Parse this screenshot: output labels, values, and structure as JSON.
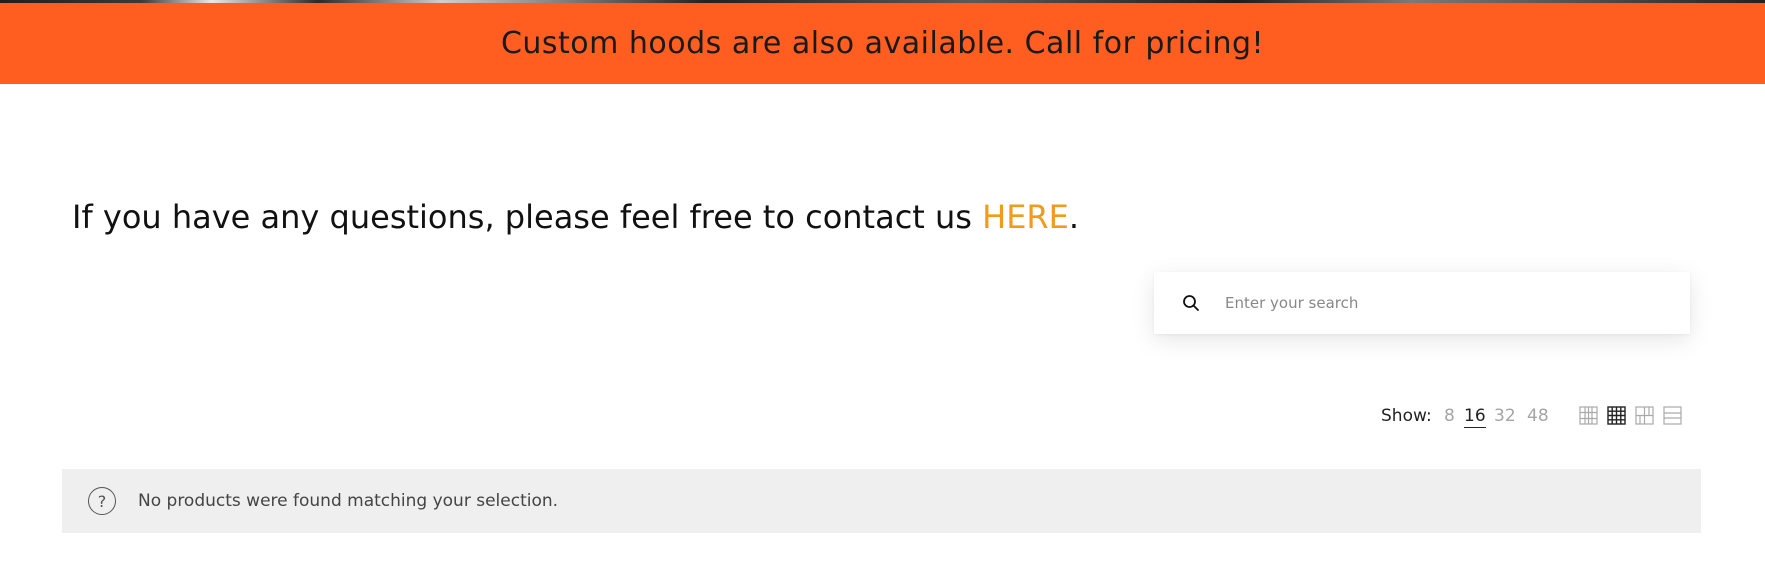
{
  "banner": {
    "text": "Custom hoods are also available. Call for pricing!",
    "background": "#ff5e20"
  },
  "contact": {
    "text": "If you have any questions, please feel free to contact us ",
    "link_label": "HERE",
    "trailing": ".",
    "link_color": "#f29a1b"
  },
  "search": {
    "placeholder": "Enter your search",
    "value": "",
    "icon": "search-icon"
  },
  "toolbar": {
    "show_label": "Show:",
    "per_page_options": [
      "8",
      "16",
      "32",
      "48"
    ],
    "per_page_selected": "16",
    "view_modes": [
      {
        "icon": "grid-2-columns-icon",
        "active": false
      },
      {
        "icon": "grid-3-columns-icon",
        "active": true
      },
      {
        "icon": "grid-4-columns-icon",
        "active": false
      },
      {
        "icon": "list-view-icon",
        "active": false
      }
    ]
  },
  "notice": {
    "icon": "question-circle-icon",
    "icon_glyph": "?",
    "text": "No products were found matching your selection."
  }
}
